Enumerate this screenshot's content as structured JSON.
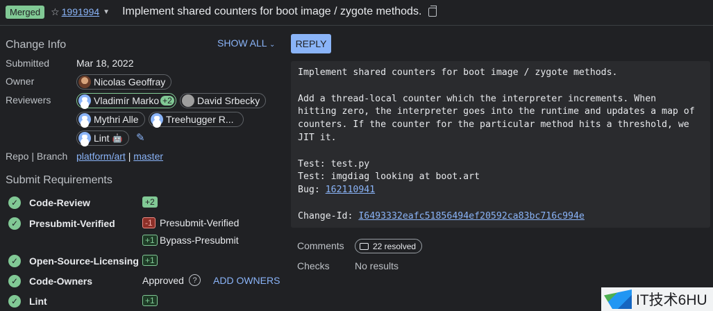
{
  "header": {
    "status": "Merged",
    "change_number": "1991994",
    "subject": "Implement shared counters for boot image / zygote methods."
  },
  "change_info": {
    "title": "Change Info",
    "show_all": "SHOW ALL",
    "submitted_label": "Submitted",
    "submitted_value": "Mar 18, 2022",
    "owner_label": "Owner",
    "owner_name": "Nicolas Geoffray",
    "reviewers_label": "Reviewers",
    "reviewers": [
      {
        "name": "Vladimír Marko",
        "vote": "+2"
      },
      {
        "name": "David Srbecky"
      },
      {
        "name": "Mythri Alle"
      },
      {
        "name": "Treehugger R..."
      },
      {
        "name": "Lint"
      }
    ],
    "repo_label": "Repo | Branch",
    "repo": "platform/art",
    "separator": "|",
    "branch": "master"
  },
  "submit_requirements": {
    "title": "Submit Requirements",
    "items": [
      {
        "name": "Code-Review",
        "votes": [
          {
            "value": "+2",
            "label": ""
          }
        ]
      },
      {
        "name": "Presubmit-Verified",
        "votes": [
          {
            "value": "-1",
            "label": "Presubmit-Verified"
          },
          {
            "value": "+1",
            "label": "Bypass-Presubmit"
          }
        ]
      },
      {
        "name": "Open-Source-Licensing",
        "votes": [
          {
            "value": "+1",
            "label": ""
          }
        ]
      },
      {
        "name": "Code-Owners",
        "status": "Approved",
        "help": "?",
        "action": "ADD OWNERS"
      },
      {
        "name": "Lint",
        "votes": [
          {
            "value": "+1",
            "label": ""
          }
        ]
      }
    ]
  },
  "reply_label": "REPLY",
  "commit_message": {
    "lines": [
      "Implement shared counters for boot image / zygote methods.",
      "",
      "Add a thread-local counter which the interpreter increments. When",
      "hitting zero, the interpreter goes into the runtime and updates a map of",
      "counters. If the counter for the particular method hits a threshold, we",
      "JIT it.",
      "",
      "Test: test.py",
      "Test: imgdiag looking at boot.art"
    ],
    "bug_label": "Bug: ",
    "bug_id": "162110941",
    "change_id_label": "Change-Id: ",
    "change_id": "I6493332eafc51856494ef20592ca83bc716c994e"
  },
  "comments": {
    "label": "Comments",
    "resolved": "22 resolved"
  },
  "checks": {
    "label": "Checks",
    "value": "No results"
  },
  "watermark": {
    "text": "IT技术6HU"
  },
  "colors": {
    "accent": "#8ab4f8",
    "positive": "#81c995",
    "negative": "#f28b82",
    "background": "#202124"
  }
}
